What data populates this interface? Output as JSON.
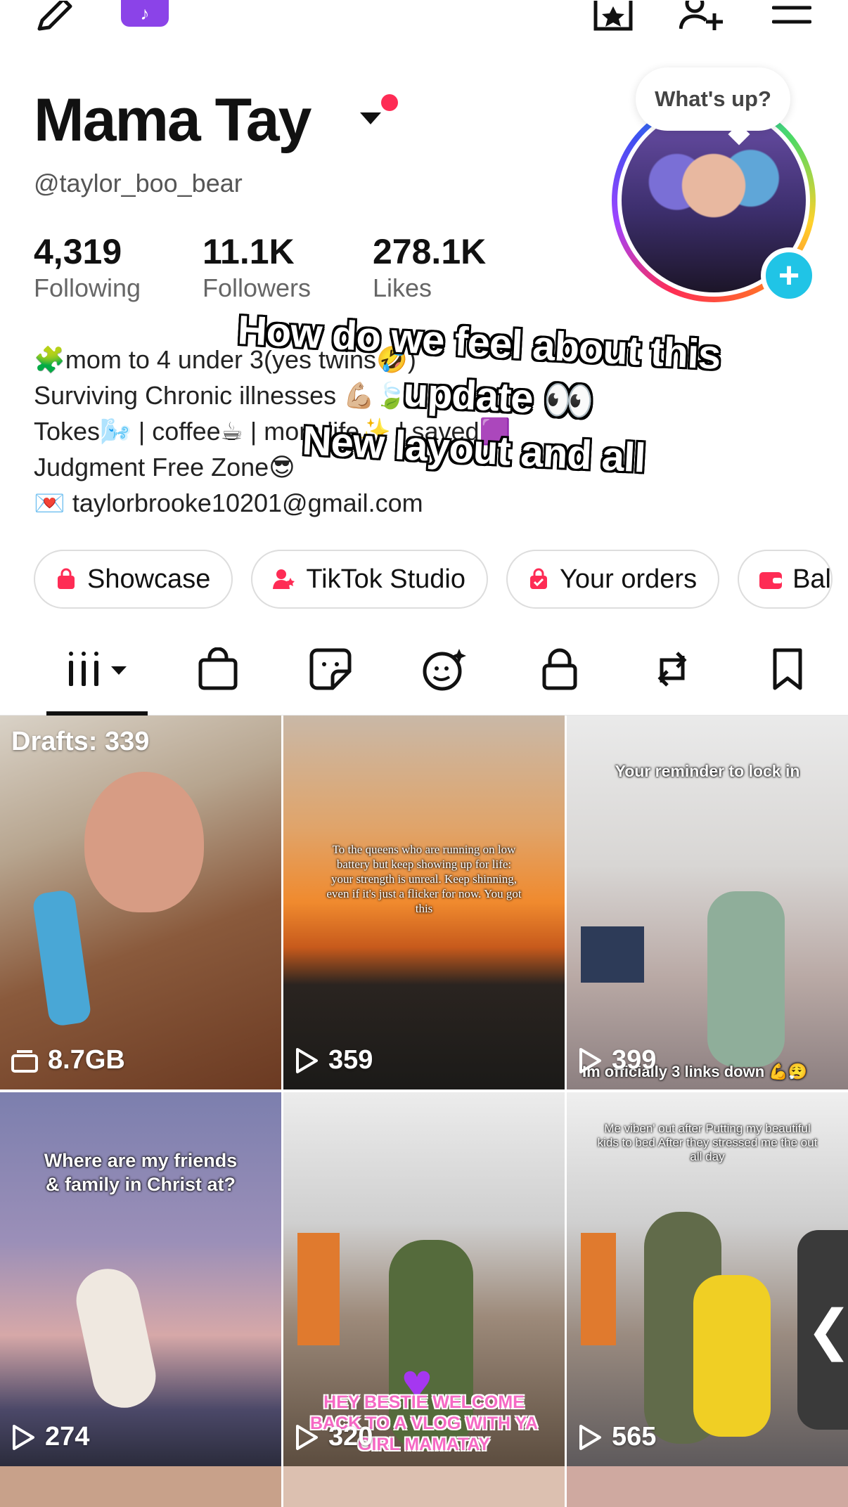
{
  "header": {
    "edit_icon": "pencil-icon",
    "tiktok_icon": "tiktok-note-icon",
    "favorites_icon": "star-box-icon",
    "add_friend_icon": "add-user-icon",
    "menu_icon": "hamburger-icon"
  },
  "profile": {
    "display_name": "Mama Tay",
    "username": "@taylor_boo_bear",
    "status_bubble": "What's up?",
    "stats": [
      {
        "value": "4,319",
        "label": "Following"
      },
      {
        "value": "11.1K",
        "label": "Followers"
      },
      {
        "value": "278.1K",
        "label": "Likes"
      }
    ],
    "bio": [
      "🧩mom to 4 under 3(yes twins🤣)",
      "Surviving Chronic illnesses 💪🏼🍃",
      "Tokes🌬️ | coffee☕ | mom life✨ | saved🟪",
      "Judgment Free Zone😎",
      "💌 taylorbrooke10201@gmail.com"
    ]
  },
  "overlay_caption": [
    "How do we feel about this",
    "update 👀",
    "New layout and all"
  ],
  "chips": [
    {
      "label": "Showcase",
      "icon": "shopping-bag-icon"
    },
    {
      "label": "TikTok Studio",
      "icon": "creator-icon"
    },
    {
      "label": "Your orders",
      "icon": "order-bag-icon"
    },
    {
      "label": "Bal",
      "icon": "wallet-icon"
    }
  ],
  "tabs": [
    {
      "icon": "grid-icon",
      "selected": true
    },
    {
      "icon": "shop-bag-icon"
    },
    {
      "icon": "sticker-icon"
    },
    {
      "icon": "ai-face-icon"
    },
    {
      "icon": "lock-icon"
    },
    {
      "icon": "repost-icon"
    },
    {
      "icon": "bookmark-icon"
    }
  ],
  "videos": [
    {
      "overlay": "Drafts: 339",
      "count": "8.7GB",
      "count_icon": "drafts-icon"
    },
    {
      "caption": "To the queens who are running on low battery but keep showing up for life: your strength is unreal. Keep shinning, even if it's just a flicker for now. You got this",
      "count": "359",
      "count_icon": "play-icon"
    },
    {
      "caption": "Your reminder to lock in",
      "caption2": "Im officially 3 links down 💪😮‍💨",
      "count": "399",
      "count_icon": "play-icon"
    },
    {
      "caption": "Where are my friends & family in Christ at?",
      "count": "274",
      "count_icon": "play-icon"
    },
    {
      "caption": "HEY BESTIE WELCOME BACK TO A VLOG WITH YA GIRL MAMATAY",
      "count": "320",
      "count_icon": "play-icon"
    },
    {
      "caption": "Me viben' out after Putting my beautiful kids to bed After they stressed me the out all day",
      "count": "565",
      "count_icon": "play-icon"
    }
  ],
  "side_handle": "❮",
  "colors": {
    "accent_red": "#fe2c55",
    "tiktok_purple": "#8b43e8",
    "plus_blue": "#20c4e6"
  }
}
